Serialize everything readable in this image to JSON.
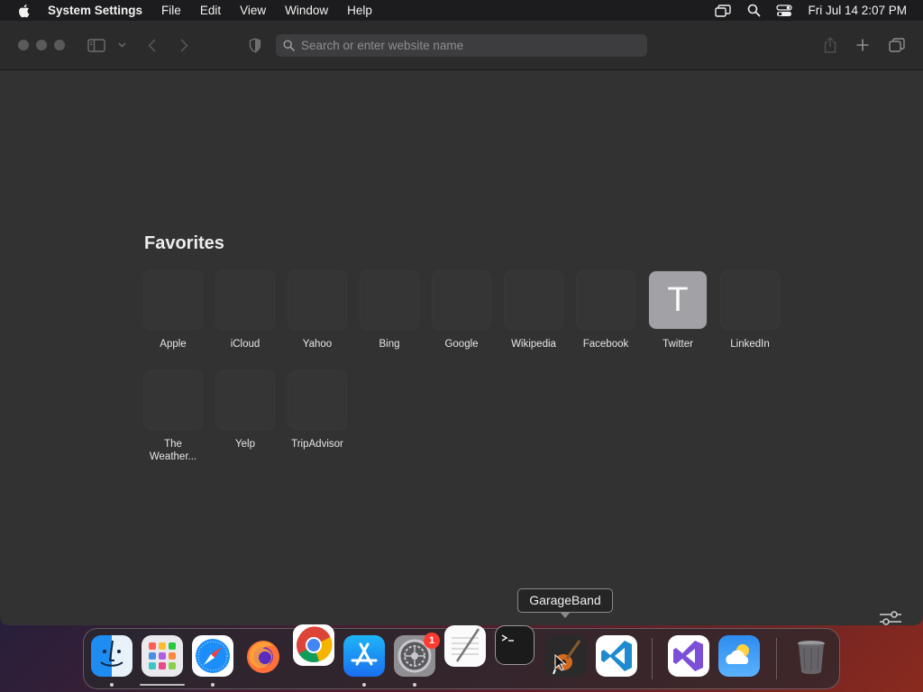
{
  "menubar": {
    "app_name": "System Settings",
    "menus": [
      "File",
      "Edit",
      "View",
      "Window",
      "Help"
    ],
    "clock": "Fri Jul 14  2:07 PM"
  },
  "toolbar": {
    "search_placeholder": "Search or enter website name"
  },
  "favorites": {
    "title": "Favorites",
    "items": [
      {
        "label": "Apple"
      },
      {
        "label": "iCloud"
      },
      {
        "label": "Yahoo"
      },
      {
        "label": "Bing"
      },
      {
        "label": "Google"
      },
      {
        "label": "Wikipedia"
      },
      {
        "label": "Facebook"
      },
      {
        "label": "Twitter",
        "letter": "T"
      },
      {
        "label": "LinkedIn"
      },
      {
        "label": "The Weather..."
      },
      {
        "label": "Yelp"
      },
      {
        "label": "TripAdvisor"
      }
    ]
  },
  "tooltip": "GarageBand",
  "dock": {
    "apps": [
      "Finder",
      "Launchpad",
      "Safari",
      "Firefox",
      "Google Chrome",
      "App Store",
      "System Settings",
      "TextEdit",
      "Terminal",
      "GarageBand",
      "Visual Studio Code",
      "Visual Studio",
      "Weather",
      "Trash"
    ],
    "system_settings_badge": "1"
  }
}
